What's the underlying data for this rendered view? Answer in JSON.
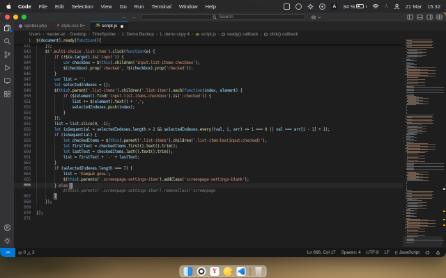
{
  "menubar": {
    "items": [
      "Code",
      "File",
      "Edit",
      "Selection",
      "View",
      "Go",
      "Run",
      "Terminal",
      "Window",
      "Help"
    ],
    "status": {
      "badge_letter": "A",
      "battery": "34 %",
      "date": "21 Mar",
      "time": "15:32"
    }
  },
  "titlebar": {
    "search_placeholder": "Search"
  },
  "tabs": [
    {
      "label": "spotter.php",
      "icon": "php",
      "active": false,
      "modified": false
    },
    {
      "label": "style.css 9+",
      "icon": "css",
      "active": false,
      "modified": false
    },
    {
      "label": "script.js",
      "icon": "js",
      "active": true,
      "modified": true
    }
  ],
  "breadcrumb": {
    "items": [
      "Users",
      "master-al",
      "Desktop",
      "TimeSpotter",
      "1. Demo Backup",
      "1. demo copy 4",
      "script.js",
      "ready() callback",
      "click() callback"
    ]
  },
  "editor": {
    "sticky": {
      "n": "1",
      "t": "$(document).ready(function(){"
    },
    "cursor_line": 666,
    "bracket_match": [
      {
        "line": 666,
        "ch": "{"
      },
      {
        "line": 667,
        "ch": "}"
      }
    ],
    "lines": [
      {
        "n": "641",
        "t": "    });"
      },
      {
        "n": "642",
        "t": "    $('.multi-choice .list-item').click(function(e) {"
      },
      {
        "n": "643",
        "t": "        if (!$(e.target).is('input')) {"
      },
      {
        "n": "644",
        "t": "            var checkbox = $(this).children('input.list-items-checkbox');"
      },
      {
        "n": "645",
        "t": "            $(checkbox).prop('checked', !$(checkbox).prop('checked'));"
      },
      {
        "n": "646",
        "t": "        }"
      },
      {
        "n": "647",
        "t": "        var list = '';"
      },
      {
        "n": "648",
        "t": "        let selectedIndexes = [];"
      },
      {
        "n": "649",
        "t": "        $(this).parent('.list-items').children('.list-item').each(function(index, element) {"
      },
      {
        "n": "650",
        "t": "            if ($(element).find('input.list-items-checkbox').is(':checked')) {"
      },
      {
        "n": "651",
        "t": "                list += $(element).text() + ',';"
      },
      {
        "n": "652",
        "t": "                selectedIndexes.push(index);"
      },
      {
        "n": "653",
        "t": "            }"
      },
      {
        "n": "654",
        "t": "        });"
      },
      {
        "n": "655",
        "t": "        list = list.slice(0, -1);"
      },
      {
        "n": "656",
        "t": "        let isSequential = selectedIndexes.length > 2 && selectedIndexes.every((val, i, arr) => i === 0 || val === arr[i - 1] + 1);"
      },
      {
        "n": "657",
        "t": "        if (isSequential) {"
      },
      {
        "n": "658",
        "t": "            let checkedItems = $(this).parent('.list-items').children('.list-item:has(input:checked)');"
      },
      {
        "n": "659",
        "t": "            let firstText = checkedItems.first().text().trim();"
      },
      {
        "n": "660",
        "t": "            let lastText = checkedItems.last().text().trim();"
      },
      {
        "n": "661",
        "t": "            list = firstText + '-' + lastText;"
      },
      {
        "n": "662",
        "t": "        }"
      },
      {
        "n": "663",
        "t": "        if (selectedIndexes.length === 7) {"
      },
      {
        "n": "664",
        "t": "            list = 'Каждый день';"
      },
      {
        "n": "665",
        "t": "            $(this).parents('.screenpage-settings-item').addClass('screenpage-settings-blank');"
      },
      {
        "n": "666",
        "t": "        } else {"
      },
      {
        "n": "",
        "t": "            $(this).parents('.screenpage-settings-item').removeClass('screenpage",
        "ghost": true
      },
      {
        "n": "667",
        "t": "        }"
      },
      {
        "n": "668",
        "t": "    });"
      },
      {
        "n": "669",
        "t": ""
      },
      {
        "n": "670",
        "t": "});"
      },
      {
        "n": "671",
        "t": ""
      }
    ]
  },
  "statusbar": {
    "errors": "0",
    "warnings": "3",
    "line_col": "Ln 666, Col 17",
    "spaces": "Spaces: 4",
    "encoding": "UTF-8",
    "eol": "LF",
    "language": "JavaScript"
  },
  "colors": {
    "accent_blue": "#0078d4",
    "js_yellow": "#e8d44d",
    "editor_bg": "#1e1e1e"
  }
}
